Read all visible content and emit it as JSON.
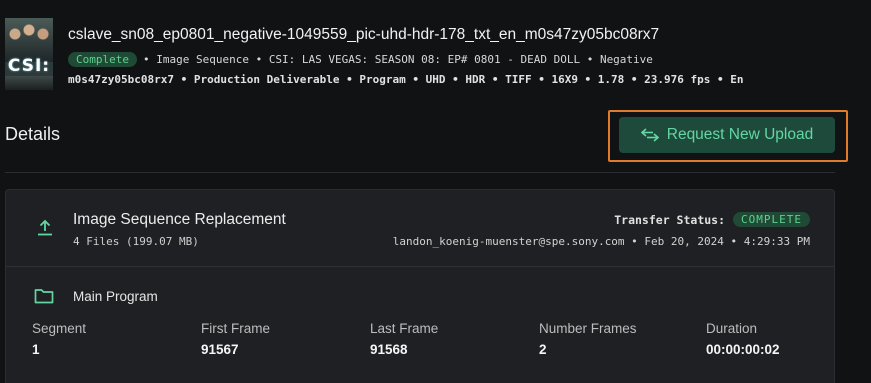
{
  "header": {
    "title": "cslave_sn08_ep0801_negative-1049559_pic-uhd-hdr-178_txt_en_m0s47zy05bc08rx7",
    "status_badge": "Complete",
    "meta_line1": "• Image Sequence • CSI: LAS VEGAS: SEASON 08: EP# 0801 - DEAD DOLL • Negative",
    "meta_line2": "m0s47zy05bc08rx7 • Production Deliverable • Program • UHD • HDR • TIFF • 16X9 • 1.78 • 23.976 fps • En",
    "thumbnail_text": "CSI:"
  },
  "details": {
    "title": "Details",
    "request_upload_label": "Request New Upload"
  },
  "card": {
    "title": "Image Sequence Replacement",
    "files": "4 Files (199.07 MB)",
    "transfer_label": "Transfer Status:",
    "transfer_status": "COMPLETE",
    "submitted_by": "landon_koenig-muenster@spe.sony.com • Feb 20, 2024 • 4:29:33 PM",
    "program_label": "Main Program",
    "columns": [
      {
        "header": "Segment",
        "value": "1"
      },
      {
        "header": "First Frame",
        "value": "91567"
      },
      {
        "header": "Last Frame",
        "value": "91568"
      },
      {
        "header": "Number Frames",
        "value": "2"
      },
      {
        "header": "Duration",
        "value": "00:00:00:02"
      }
    ]
  },
  "colors": {
    "accent_green": "#63d6a2",
    "badge_bg": "#1f4a35",
    "highlight_orange": "#e07a2c"
  },
  "icons": [
    "upload-icon",
    "folder-icon",
    "swap-arrows-icon"
  ]
}
